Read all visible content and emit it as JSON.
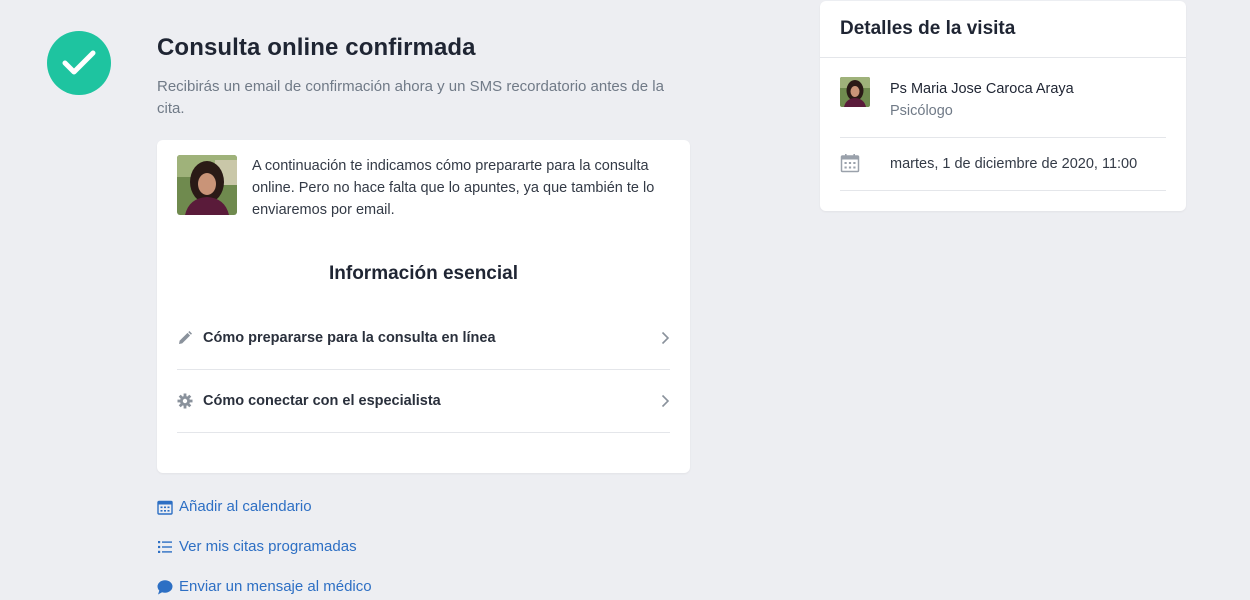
{
  "confirmation": {
    "title": "Consulta online confirmada",
    "subtitle": "Recibirás un email de confirmación ahora y un SMS recordatorio antes de la cita."
  },
  "main_card": {
    "intro": "A continuación te indicamos cómo prepararte para la consulta online. Pero no hace falta que lo apuntes, ya que también te lo enviaremos por email.",
    "section_title": "Información esencial",
    "items": [
      {
        "label": "Cómo prepararse para la consulta en línea",
        "icon": "pencil-icon"
      },
      {
        "label": "Cómo conectar con el especialista",
        "icon": "gear-icon"
      }
    ]
  },
  "links": [
    {
      "label": "Añadir al calendario",
      "icon": "calendar-icon"
    },
    {
      "label": "Ver mis citas programadas",
      "icon": "list-icon"
    },
    {
      "label": "Enviar un mensaje al médico",
      "icon": "chat-bubble-icon"
    }
  ],
  "visit_details": {
    "title": "Detalles de la visita",
    "doctor_name": "Ps Maria Jose Caroca Araya",
    "doctor_role": "Psicólogo",
    "datetime": "martes, 1 de diciembre de 2020, 11:00"
  },
  "colors": {
    "accent": "#1ec4a0",
    "link": "#2d6fc4",
    "background": "#edeef2"
  }
}
